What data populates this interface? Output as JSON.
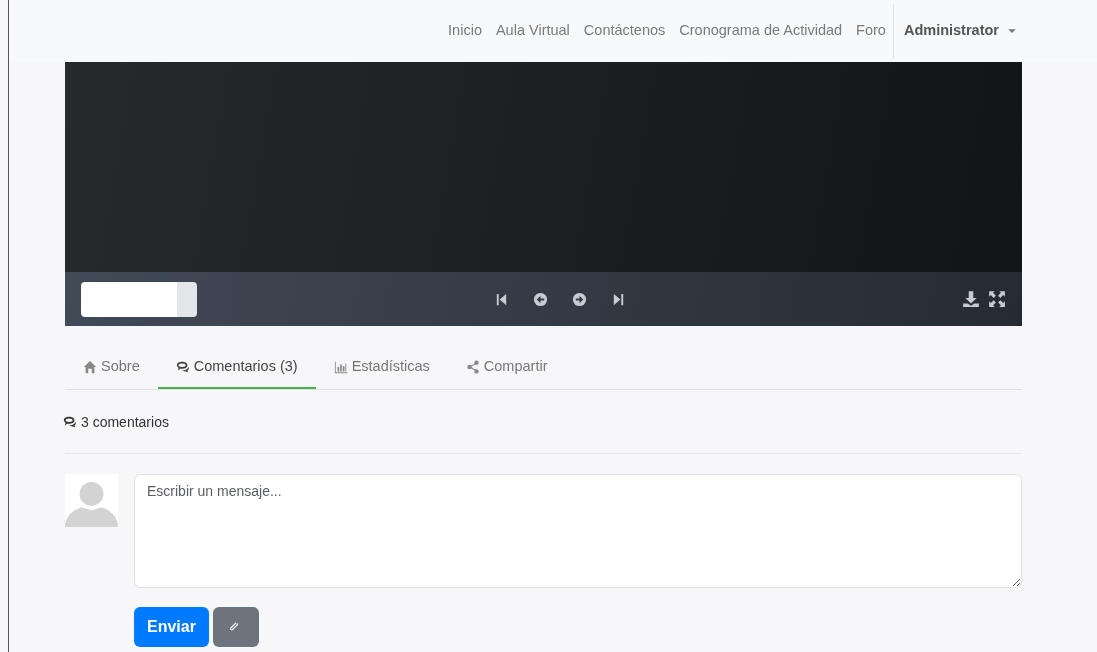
{
  "navbar": {
    "links": [
      "Inicio",
      "Aula Virtual",
      "Contáctenos",
      "Cronograma de Actividad",
      "Foro"
    ],
    "user_menu": "Administrator"
  },
  "tabs": [
    {
      "label": "Sobre",
      "selected": false
    },
    {
      "label": "Comentarios (3)",
      "selected": true
    },
    {
      "label": "Estadísticas",
      "selected": false
    },
    {
      "label": "Compartir",
      "selected": false
    }
  ],
  "comment_count": "3 comentarios",
  "composer": {
    "placeholder": "Escribir un mensaje...",
    "send_button": "Enviar"
  }
}
